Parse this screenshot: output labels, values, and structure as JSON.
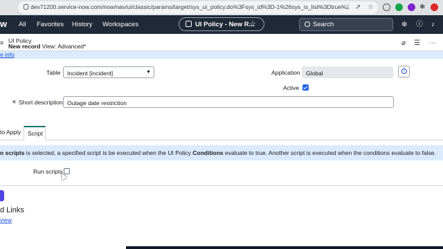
{
  "browser": {
    "url": "dev71200.service-now.com/now/nav/ui/classic/params/target/sys_ui_policy.do%3Fsys_id%3D-1%26sys_is_list%3Dtrue%26sys_target..."
  },
  "topnav": {
    "logo": "w",
    "items": [
      "All",
      "Favorites",
      "History",
      "Workspaces"
    ],
    "pill_title": "UI Policy - New R...",
    "search_placeholder": "Search"
  },
  "header": {
    "title": "UI Policy",
    "record": "New record",
    "view": "View: Advanced*"
  },
  "info_link": "e info",
  "form": {
    "table_label": "Table",
    "table_value": "Incident [incident]",
    "application_label": "Application",
    "application_value": "Global",
    "active_label": "Active",
    "active_checked": true,
    "short_description_label": "Short description",
    "short_description_value": "Outage date restriction"
  },
  "tabs": [
    {
      "label": "to Apply",
      "active": false
    },
    {
      "label": "Script",
      "active": true
    }
  ],
  "notice": {
    "part1": "n scripts",
    "part2": " is selected, a specified script is be executed when the UI Policy ",
    "part3": "Conditions",
    "part4": " evaluate to true. Another script is executed when the conditions evaluate to false."
  },
  "run_scripts_label": "Run scripts",
  "run_scripts_checked": false,
  "related": {
    "title": "d Links",
    "link": "view"
  },
  "colors": {
    "nav_bg": "#1f2937",
    "accent": "#2563eb",
    "info_band": "#dbeafe",
    "tab_active": "#0f766e"
  }
}
